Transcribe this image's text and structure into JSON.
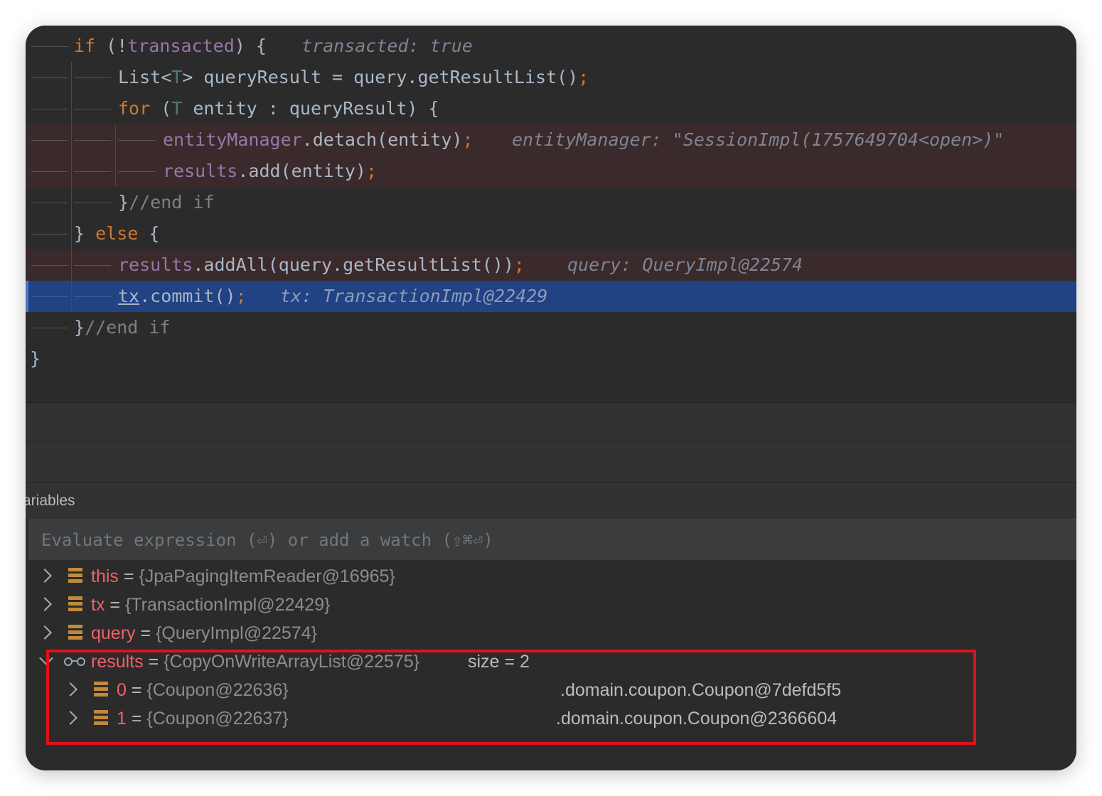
{
  "code": {
    "lines": [
      {
        "parts": [
          [
            "kw",
            "if"
          ],
          [
            "",
            "·(!"
          ],
          [
            "fld",
            "transacted"
          ],
          [
            "",
            ")·{"
          ]
        ],
        "hint": "transacted: true"
      },
      {
        "parts": [
          [
            "",
            "List<"
          ],
          [
            "tp",
            "T"
          ],
          [
            "",
            "> queryResult = query.getResultList()"
          ],
          [
            "semi",
            ";"
          ]
        ],
        "hint": ""
      },
      {
        "parts": [
          [
            "kw",
            "for"
          ],
          [
            "",
            "·("
          ],
          [
            "tp",
            "T"
          ],
          [
            "",
            "·entity : queryResult)·{"
          ]
        ],
        "hint": ""
      },
      {
        "parts": [
          [
            "fld",
            "entityManager"
          ],
          [
            "",
            ".detach(entity)"
          ],
          [
            "semi",
            ";"
          ]
        ],
        "hint": "entityManager: \"SessionImpl(1757649704<open>)\""
      },
      {
        "parts": [
          [
            "fld",
            "results"
          ],
          [
            "",
            ".add(entity)"
          ],
          [
            "semi",
            ";"
          ]
        ],
        "hint": ""
      },
      {
        "parts": [
          [
            "",
            "}"
          ],
          [
            "cmt",
            "//end·if"
          ]
        ],
        "hint": ""
      },
      {
        "parts": [
          [
            "",
            "}·"
          ],
          [
            "kw",
            "else"
          ],
          [
            "",
            "·{"
          ]
        ],
        "hint": ""
      },
      {
        "parts": [
          [
            "fld",
            "results"
          ],
          [
            "",
            ".addAll(query.getResultList())"
          ],
          [
            "semi",
            ";"
          ]
        ],
        "hint": "query: QueryImpl@22574"
      },
      {
        "parts": [
          [
            "u",
            "tx"
          ],
          [
            "",
            ".commit()"
          ],
          [
            "semi",
            ";"
          ]
        ],
        "hint": "tx: TransactionImpl@22429"
      },
      {
        "parts": [
          [
            "",
            "}"
          ],
          [
            "cmt",
            "//end·if"
          ]
        ],
        "hint": ""
      },
      {
        "parts": [
          [
            "",
            "}"
          ]
        ],
        "hint": ""
      }
    ]
  },
  "variables_panel": {
    "title": "ariables",
    "eval_placeholder": "Evaluate expression (⏎) or add a watch (⇧⌘⏎)",
    "items": [
      {
        "name": "this",
        "eq": " = ",
        "value": "{JpaPagingItemReader@16965}",
        "extra": "",
        "expanded": false,
        "icon": "field-icon"
      },
      {
        "name": "tx",
        "eq": " = ",
        "value": "{TransactionImpl@22429}",
        "extra": "",
        "expanded": false,
        "icon": "field-icon"
      },
      {
        "name": "query",
        "eq": " = ",
        "value": "{QueryImpl@22574}",
        "extra": "",
        "expanded": false,
        "icon": "field-icon"
      },
      {
        "name": "results",
        "eq": " = ",
        "value": "{CopyOnWriteArrayList@22575}",
        "extra": "size = 2",
        "expanded": true,
        "icon": "watch-glasses-icon"
      },
      {
        "name": "0",
        "eq": " = ",
        "value": "{Coupon@22636}",
        "extra": ".domain.coupon.Coupon@7defd5f5",
        "expanded": false,
        "icon": "field-icon"
      },
      {
        "name": "1",
        "eq": " = ",
        "value": "{Coupon@22637}",
        "extra": ".domain.coupon.Coupon@2366604",
        "expanded": false,
        "icon": "field-icon"
      }
    ]
  },
  "colors": {
    "keyword": "#cc7832",
    "field": "#9876aa",
    "breakpoint_line": "#3b2a2b",
    "execution_line": "#214283",
    "variable_name": "#f0626a",
    "highlight_box": "#e3101e"
  }
}
